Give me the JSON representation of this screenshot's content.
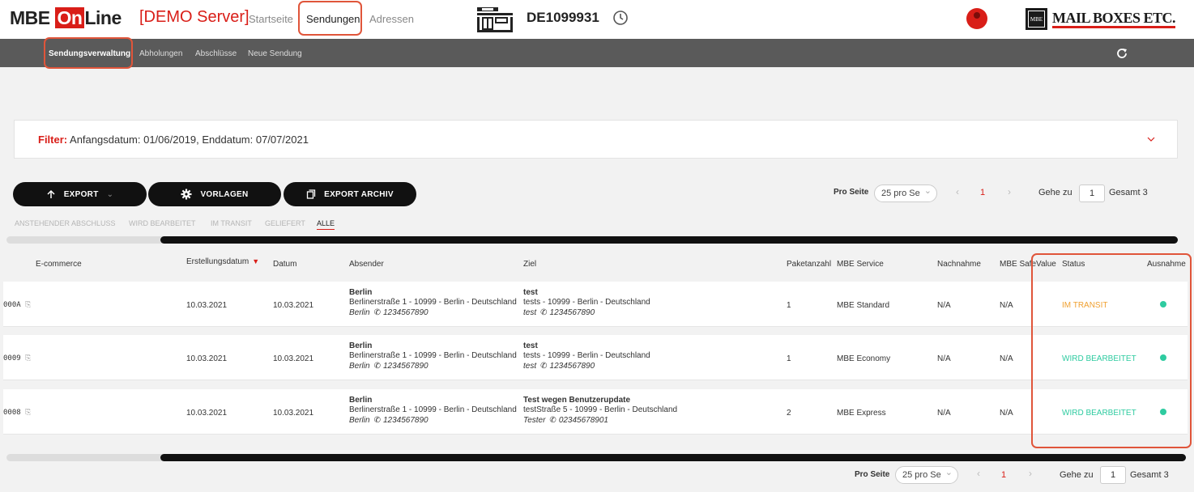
{
  "brand": {
    "logo_main": "MBE",
    "logo_on": "On",
    "logo_line": "Line",
    "server": "[DEMO Server]",
    "partner_logo_box": "MBE",
    "partner_logo_text": "MAIL BOXES ETC."
  },
  "nav": {
    "items": [
      "Startseite",
      "Sendungen",
      "Adressen"
    ],
    "active": "Sendungen"
  },
  "customer_id": "DE1099931",
  "subnav": {
    "items": [
      "Sendungsverwaltung",
      "Abholungen",
      "Abschlüsse",
      "Neue Sendung"
    ],
    "active": "Sendungsverwaltung"
  },
  "filter": {
    "label": "Filter:",
    "text": "Anfangsdatum: 01/06/2019, Enddatum: 07/07/2021"
  },
  "actions": {
    "export": "EXPORT",
    "vorlagen": "VORLAGEN",
    "export_archiv": "EXPORT ARCHIV"
  },
  "pagination": {
    "per_page_label": "Pro Seite",
    "per_page_value": "25 pro Se",
    "current_page": "1",
    "goto_label": "Gehe zu",
    "goto_value": "1",
    "total": "Gesamt 3"
  },
  "status_tabs": [
    "ANSTEHENDER ABSCHLUSS",
    "WIRD BEARBEITET",
    "IM TRANSIT",
    "GELIEFERT",
    "ALLE"
  ],
  "status_tabs_active": "ALLE",
  "columns": [
    "E-commerce",
    "Erstellungsdatum",
    "Datum",
    "Absender",
    "Ziel",
    "Paketanzahl",
    "MBE Service",
    "Nachnahme",
    "MBE SafeValue",
    "Status",
    "Ausnahme"
  ],
  "rows": [
    {
      "id": "000A",
      "created": "10.03.2021",
      "date": "10.03.2021",
      "sender_name": "Berlin",
      "sender_addr": "Berlinerstraße 1 - 10999 - Berlin - Deutschland",
      "sender_contact": "Berlin",
      "sender_phone": "1234567890",
      "dest_name": "test",
      "dest_addr": "tests - 10999 - Berlin - Deutschland",
      "dest_contact": "test",
      "dest_phone": "1234567890",
      "packages": "1",
      "service": "MBE Standard",
      "cod": "N/A",
      "safevalue": "N/A",
      "status": "IM TRANSIT",
      "status_color": "#f0a030"
    },
    {
      "id": "0009",
      "created": "10.03.2021",
      "date": "10.03.2021",
      "sender_name": "Berlin",
      "sender_addr": "Berlinerstraße 1 - 10999 - Berlin - Deutschland",
      "sender_contact": "Berlin",
      "sender_phone": "1234567890",
      "dest_name": "test",
      "dest_addr": "tests - 10999 - Berlin - Deutschland",
      "dest_contact": "test",
      "dest_phone": "1234567890",
      "packages": "1",
      "service": "MBE Economy",
      "cod": "N/A",
      "safevalue": "N/A",
      "status": "WIRD BEARBEITET",
      "status_color": "#2ecba0"
    },
    {
      "id": "0008",
      "created": "10.03.2021",
      "date": "10.03.2021",
      "sender_name": "Berlin",
      "sender_addr": "Berlinerstraße 1 - 10999 - Berlin - Deutschland",
      "sender_contact": "Berlin",
      "sender_phone": "1234567890",
      "dest_name": "Test wegen Benutzerupdate",
      "dest_addr": "testStraße 5 - 10999 - Berlin - Deutschland",
      "dest_contact": "Tester",
      "dest_phone": "02345678901",
      "packages": "2",
      "service": "MBE Express",
      "cod": "N/A",
      "safevalue": "N/A",
      "status": "WIRD BEARBEITET",
      "status_color": "#2ecba0"
    }
  ],
  "colors": {
    "brand_red": "#d91e18",
    "highlight": "#e0553a",
    "subnav_bg": "#5a5a5a",
    "exception_dot": "#2ecba0"
  }
}
